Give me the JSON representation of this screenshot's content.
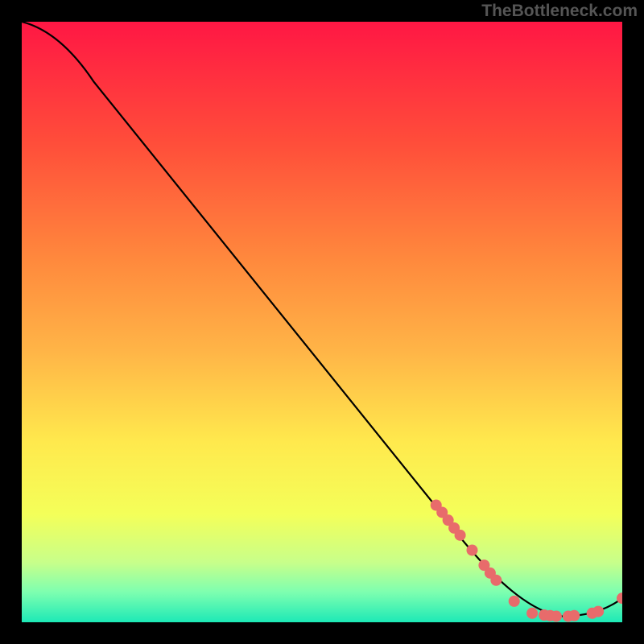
{
  "watermark": "TheBottleneck.com",
  "chart_data": {
    "type": "line",
    "title": "",
    "xlabel": "",
    "ylabel": "",
    "xlim": [
      0,
      100
    ],
    "ylim": [
      0,
      100
    ],
    "grid": false,
    "gradient_stops": [
      {
        "offset": 0,
        "color": "#FF1744"
      },
      {
        "offset": 20,
        "color": "#FF4D3A"
      },
      {
        "offset": 40,
        "color": "#FF8A3D"
      },
      {
        "offset": 55,
        "color": "#FFB547"
      },
      {
        "offset": 70,
        "color": "#FFE94D"
      },
      {
        "offset": 82,
        "color": "#F4FF59"
      },
      {
        "offset": 90,
        "color": "#C8FF8A"
      },
      {
        "offset": 95,
        "color": "#7DFFB0"
      },
      {
        "offset": 100,
        "color": "#1DE9B6"
      }
    ],
    "curve": [
      {
        "x": 0,
        "y": 100
      },
      {
        "x": 4,
        "y": 98
      },
      {
        "x": 8,
        "y": 95
      },
      {
        "x": 12,
        "y": 90
      },
      {
        "x": 70,
        "y": 18
      },
      {
        "x": 80,
        "y": 5
      },
      {
        "x": 85,
        "y": 1.5
      },
      {
        "x": 90,
        "y": 1.0
      },
      {
        "x": 95,
        "y": 1.5
      },
      {
        "x": 100,
        "y": 4
      }
    ],
    "markers": [
      {
        "x": 69,
        "y": 19.5
      },
      {
        "x": 70,
        "y": 18.3
      },
      {
        "x": 71,
        "y": 17.0
      },
      {
        "x": 72,
        "y": 15.7
      },
      {
        "x": 73,
        "y": 14.5
      },
      {
        "x": 75,
        "y": 12.0
      },
      {
        "x": 77,
        "y": 9.5
      },
      {
        "x": 78,
        "y": 8.2
      },
      {
        "x": 79,
        "y": 7.0
      },
      {
        "x": 82,
        "y": 3.5
      },
      {
        "x": 85,
        "y": 1.5
      },
      {
        "x": 87,
        "y": 1.2
      },
      {
        "x": 88,
        "y": 1.1
      },
      {
        "x": 89,
        "y": 1.0
      },
      {
        "x": 91,
        "y": 1.0
      },
      {
        "x": 92,
        "y": 1.1
      },
      {
        "x": 95,
        "y": 1.5
      },
      {
        "x": 96,
        "y": 1.8
      },
      {
        "x": 100,
        "y": 4.0
      }
    ],
    "marker_color": "#E86B6B",
    "curve_color": "#000000"
  }
}
